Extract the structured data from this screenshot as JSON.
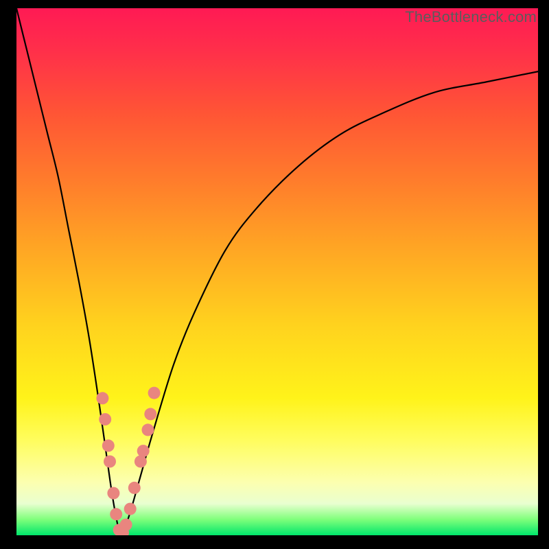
{
  "watermark": "TheBottleneck.com",
  "colors": {
    "curve": "#000000",
    "marker_fill": "#e9857f",
    "marker_stroke": "#cf6a63",
    "frame": "#000000"
  },
  "chart_data": {
    "type": "line",
    "title": "",
    "xlabel": "",
    "ylabel": "",
    "xlim": [
      0,
      100
    ],
    "ylim": [
      0,
      100
    ],
    "note": "No axis ticks or numeric labels are rendered; x is a normalized horizontal position (0–100) and y is bottleneck percentage where 0 = green/ideal and 100 = red/maximum. Values are read from the plotted curve's pixel coordinates.",
    "series": [
      {
        "name": "bottleneck-curve",
        "x": [
          0,
          2,
          4,
          6,
          8,
          10,
          12,
          14,
          16,
          18,
          19,
          20,
          21,
          22,
          24,
          26,
          30,
          34,
          40,
          46,
          54,
          62,
          70,
          80,
          90,
          100
        ],
        "y": [
          100,
          92,
          84,
          76,
          68,
          58,
          48,
          37,
          24,
          10,
          4,
          0,
          2,
          5,
          12,
          19,
          32,
          42,
          54,
          62,
          70,
          76,
          80,
          84,
          86,
          88
        ]
      }
    ],
    "markers": {
      "name": "highlighted-points",
      "note": "Clustered data markers near the curve minimum.",
      "points": [
        {
          "x": 16.5,
          "y": 26
        },
        {
          "x": 17.0,
          "y": 22
        },
        {
          "x": 17.6,
          "y": 17
        },
        {
          "x": 17.9,
          "y": 14
        },
        {
          "x": 18.6,
          "y": 8
        },
        {
          "x": 19.1,
          "y": 4
        },
        {
          "x": 19.7,
          "y": 1
        },
        {
          "x": 20.4,
          "y": 0.5
        },
        {
          "x": 21.0,
          "y": 2
        },
        {
          "x": 21.8,
          "y": 5
        },
        {
          "x": 22.6,
          "y": 9
        },
        {
          "x": 23.8,
          "y": 14
        },
        {
          "x": 24.3,
          "y": 16
        },
        {
          "x": 25.2,
          "y": 20
        },
        {
          "x": 25.7,
          "y": 23
        },
        {
          "x": 26.4,
          "y": 27
        }
      ]
    }
  }
}
